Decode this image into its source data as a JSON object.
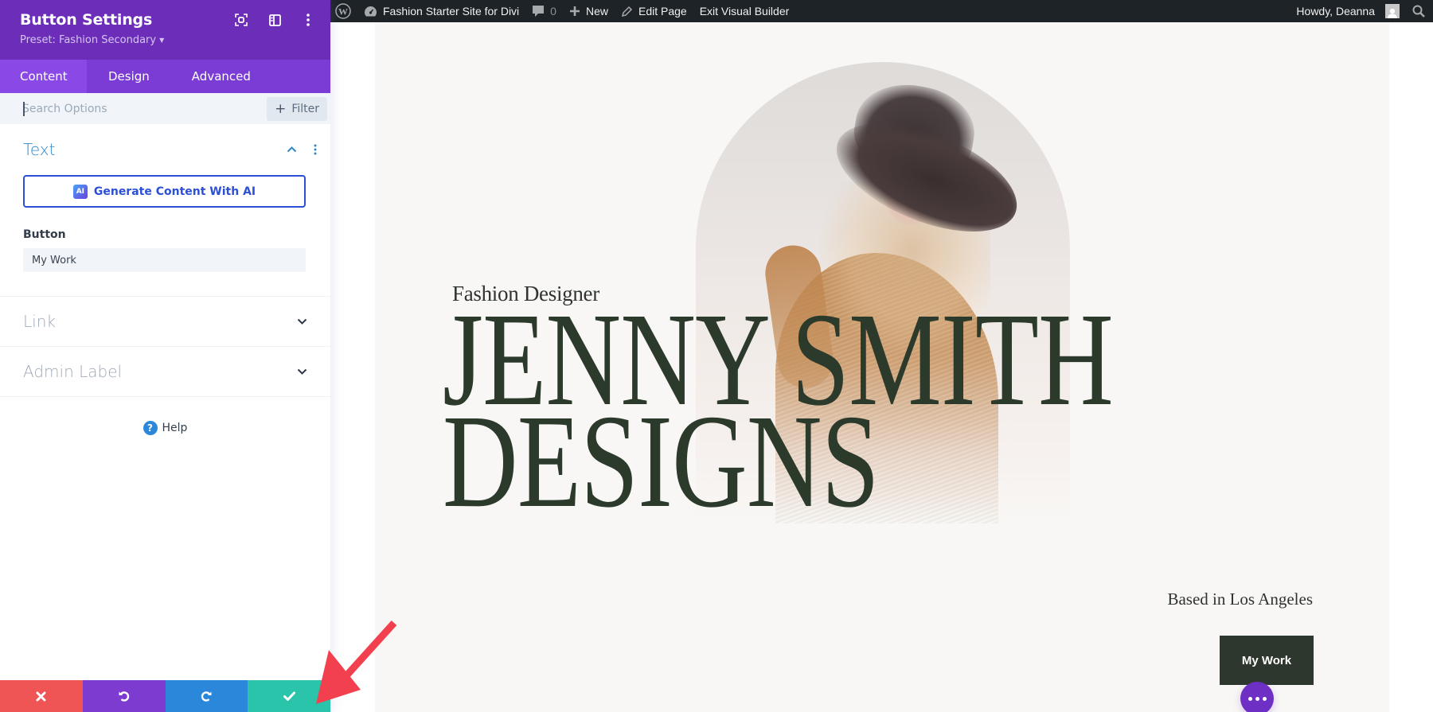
{
  "sidebar": {
    "title": "Button Settings",
    "preset": "Preset: Fashion Secondary",
    "header_icons": [
      "focus-icon",
      "split-view-icon",
      "more-vertical-icon"
    ],
    "tabs": [
      {
        "label": "Content",
        "active": true
      },
      {
        "label": "Design",
        "active": false
      },
      {
        "label": "Advanced",
        "active": false
      }
    ],
    "search": {
      "placeholder": "Search Options",
      "value": ""
    },
    "filter_label": "Filter",
    "sections": {
      "text": {
        "title": "Text",
        "expanded": true,
        "ai_button": "Generate Content With AI",
        "ai_badge": "AI",
        "field_label": "Button",
        "field_value": "My Work"
      },
      "link": {
        "title": "Link",
        "expanded": false
      },
      "admin_label": {
        "title": "Admin Label",
        "expanded": false
      }
    },
    "help_label": "Help",
    "footer": {
      "discard": "discard-icon",
      "undo": "undo-icon",
      "redo": "redo-icon",
      "save": "save-check-icon"
    },
    "colors": {
      "header": "#6c2eb9",
      "tabs": "#7b3bd5",
      "discard": "#ef5555",
      "undo": "#7e3bd0",
      "redo": "#2b87da",
      "save": "#29c4a9"
    }
  },
  "adminbar": {
    "site_name": "Fashion Starter Site for Divi",
    "comments_count": "0",
    "new_label": "New",
    "edit_label": "Edit Page",
    "exit_label": "Exit Visual Builder",
    "howdy": "Howdy, Deanna"
  },
  "page": {
    "eyebrow": "Fashion Designer",
    "headline_line1": "JENNY SMITH",
    "headline_line2": "DESIGNS",
    "location": "Based in Los Angeles",
    "button_label": "My Work",
    "colors": {
      "background": "#f9f7f5",
      "headline": "#2c3a2c",
      "button": "#2d372d",
      "fab": "#6e2fc4"
    }
  }
}
